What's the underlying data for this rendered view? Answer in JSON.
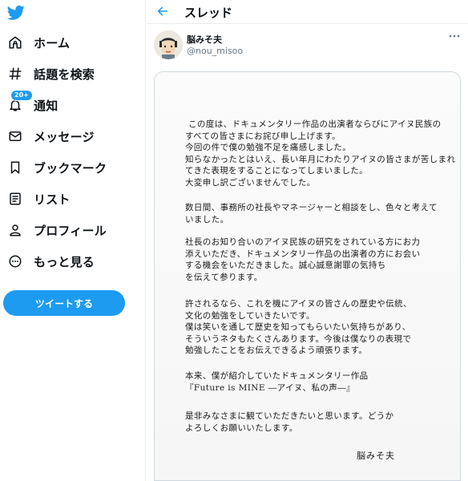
{
  "sidebar": {
    "items": [
      {
        "label": "ホーム",
        "icon": "home-icon"
      },
      {
        "label": "話題を検索",
        "icon": "hashtag-icon"
      },
      {
        "label": "通知",
        "icon": "bell-icon",
        "badge": "20+"
      },
      {
        "label": "メッセージ",
        "icon": "envelope-icon"
      },
      {
        "label": "ブックマーク",
        "icon": "bookmark-icon"
      },
      {
        "label": "リスト",
        "icon": "list-icon"
      },
      {
        "label": "プロフィール",
        "icon": "person-icon"
      },
      {
        "label": "もっと見る",
        "icon": "more-circle-icon"
      }
    ],
    "tweet_button": "ツイートする"
  },
  "header": {
    "title": "スレッド"
  },
  "tweet": {
    "user_name": "脳みそ夫",
    "user_handle": "@nou_misoo"
  },
  "letter": {
    "paragraphs": [
      [
        "この度は、ドキュメンタリー作品の出演者ならびにアイヌ民族の",
        "すべての皆さまにお詫び申し上げます。",
        "今回の件で僕の勉強不足を痛感しました。",
        "知らなかったとはいえ、長い年月にわたりアイヌの皆さまが苦しまれ",
        "てきた表現をすることになってしまいました。",
        "大変申し訳ございませんでした。"
      ],
      [
        "数日間、事務所の社長やマネージャーと相談をし、色々と考えて",
        "いました。"
      ],
      [
        "社長のお知り合いのアイヌ民族の研究をされている方にお力",
        "添えいただき、ドキュメンタリー作品の出演者の方にお会い",
        "する機会をいただきました。誠心誠意謝罪の気持ち",
        "を伝えて参ります。"
      ],
      [
        "許されるなら、これを機にアイヌの皆さんの歴史や伝統、",
        "文化の勉強をしていきたいです。",
        "僕は笑いを通して歴史を知ってもらいたい気持ちがあり、",
        "そういうネタもたくさんあります。今後は僕なりの表現で",
        "勉強したことをお伝えできるよう頑張ります。"
      ],
      [
        "本来、僕が紹介していたドキュメンタリー作品",
        "『Future is MINE ―アイヌ、私の声―』"
      ],
      [
        "是非みなさまに観ていただきたいと思います。どうか",
        "よろしくお願いいたします。"
      ]
    ],
    "signature": "脳みそ夫"
  },
  "colors": {
    "accent": "#1d9bf0",
    "text": "#0f1419",
    "muted": "#657786"
  }
}
